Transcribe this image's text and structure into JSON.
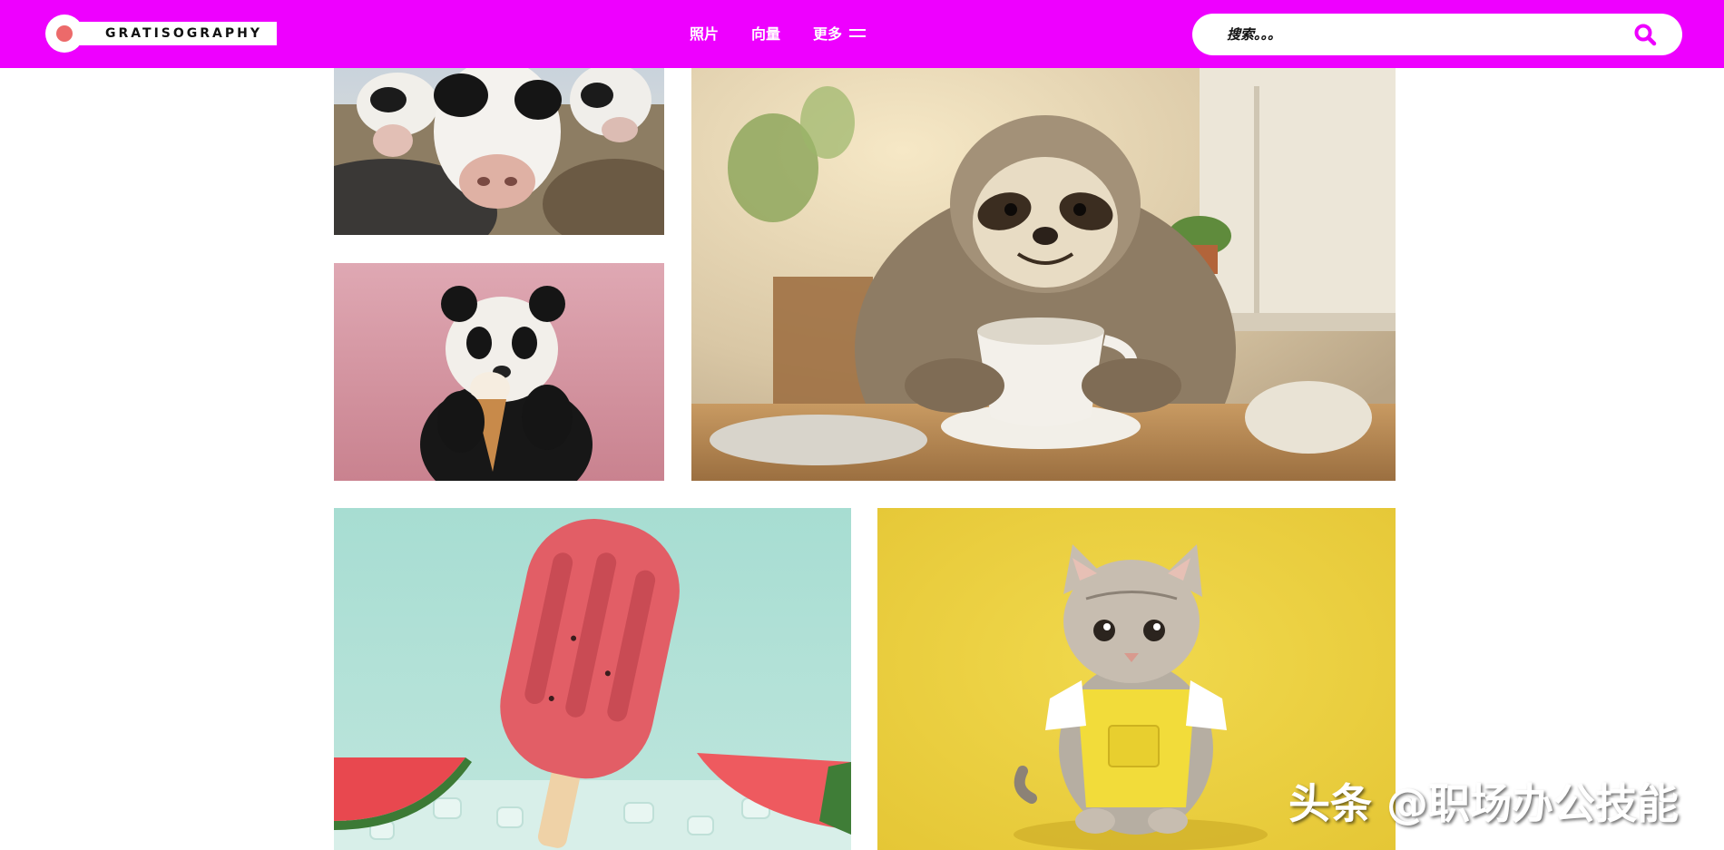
{
  "header": {
    "logo_text": "GRATISOGRAPHY",
    "nav": [
      {
        "label": "照片"
      },
      {
        "label": "向量"
      },
      {
        "label": "更多"
      }
    ],
    "search": {
      "placeholder": "搜索。。。"
    },
    "colors": {
      "bar": "#ee00ff",
      "logo_dot": "#ec6a6a",
      "search_icon": "#ee00ff"
    }
  },
  "gallery": [
    {
      "subject": "cow"
    },
    {
      "subject": "sloth"
    },
    {
      "subject": "panda"
    },
    {
      "subject": "popsicle"
    },
    {
      "subject": "kitten"
    }
  ],
  "watermark": "头条 @职场办公技能"
}
